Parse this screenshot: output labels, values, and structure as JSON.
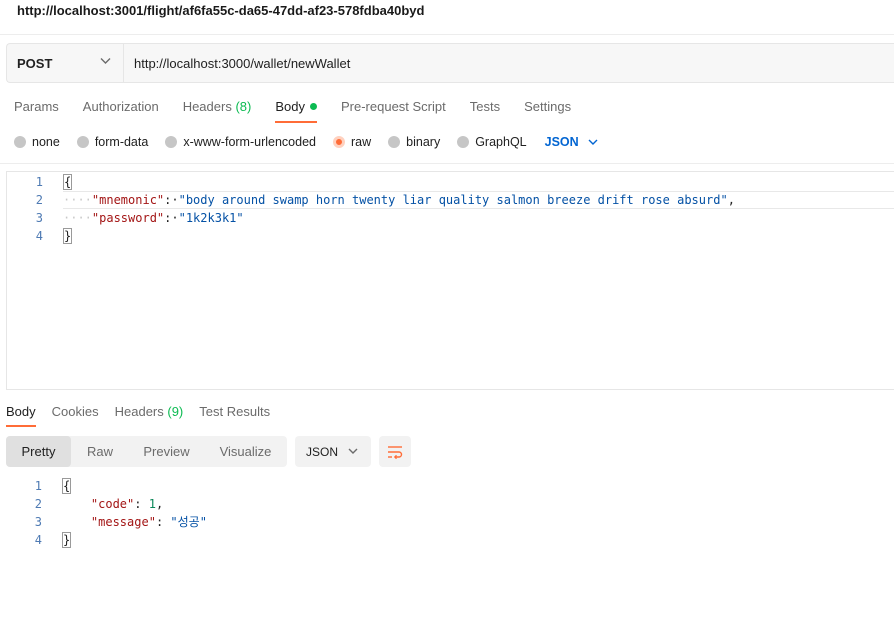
{
  "page_url": "http://localhost:3001/flight/af6fa55c-da65-47dd-af23-578fdba40byd",
  "request": {
    "method": "POST",
    "url": "http://localhost:3000/wallet/newWallet"
  },
  "request_tabs": [
    {
      "label": "Params"
    },
    {
      "label": "Authorization"
    },
    {
      "label": "Headers",
      "count": "(8)"
    },
    {
      "label": "Body"
    },
    {
      "label": "Pre-request Script"
    },
    {
      "label": "Tests"
    },
    {
      "label": "Settings"
    }
  ],
  "body_types": [
    {
      "label": "none"
    },
    {
      "label": "form-data"
    },
    {
      "label": "x-www-form-urlencoded"
    },
    {
      "label": "raw"
    },
    {
      "label": "binary"
    },
    {
      "label": "GraphQL"
    }
  ],
  "body_language": "JSON",
  "request_body": {
    "line_numbers": [
      "1",
      "2",
      "3",
      "4"
    ],
    "open_brace": "{",
    "close_brace": "}",
    "key1": "\"mnemonic\"",
    "val1": "\"body around swamp horn twenty liar quality salmon breeze drift rose absurd\"",
    "key2": "\"password\"",
    "val2": "\"1k2k3k1\""
  },
  "response_tabs": [
    {
      "label": "Body"
    },
    {
      "label": "Cookies"
    },
    {
      "label": "Headers",
      "count": "(9)"
    },
    {
      "label": "Test Results"
    }
  ],
  "view_modes": [
    "Pretty",
    "Raw",
    "Preview",
    "Visualize"
  ],
  "response_language": "JSON",
  "response_body": {
    "line_numbers": [
      "1",
      "2",
      "3",
      "4"
    ],
    "open_brace": "{",
    "close_brace": "}",
    "key1": "\"code\"",
    "val1": "1",
    "key2": "\"message\"",
    "val2": "\"성공\""
  },
  "colors": {
    "accent": "#ff6c37",
    "link_blue": "#0265d2",
    "count_green": "#0cbb52"
  }
}
